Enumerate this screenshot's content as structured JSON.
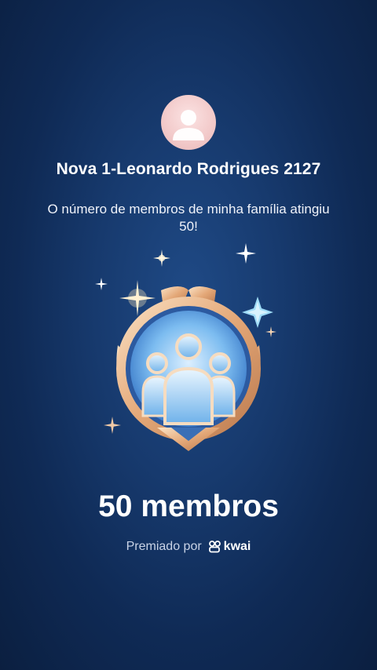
{
  "profile": {
    "name": "Nova 1-Leonardo Rodrigues 2127",
    "message": "O número de membros de minha família atingiu 50!"
  },
  "badge": {
    "icon": "family-members-badge-icon",
    "title": "50 membros"
  },
  "footer": {
    "awarded_by": "Premiado por",
    "brand": "kwai",
    "brand_icon": "kwai-logo-icon"
  },
  "colors": {
    "background": "#14356a",
    "badge_gold": "#e9b98a",
    "badge_blue": "#6fb4ea"
  }
}
